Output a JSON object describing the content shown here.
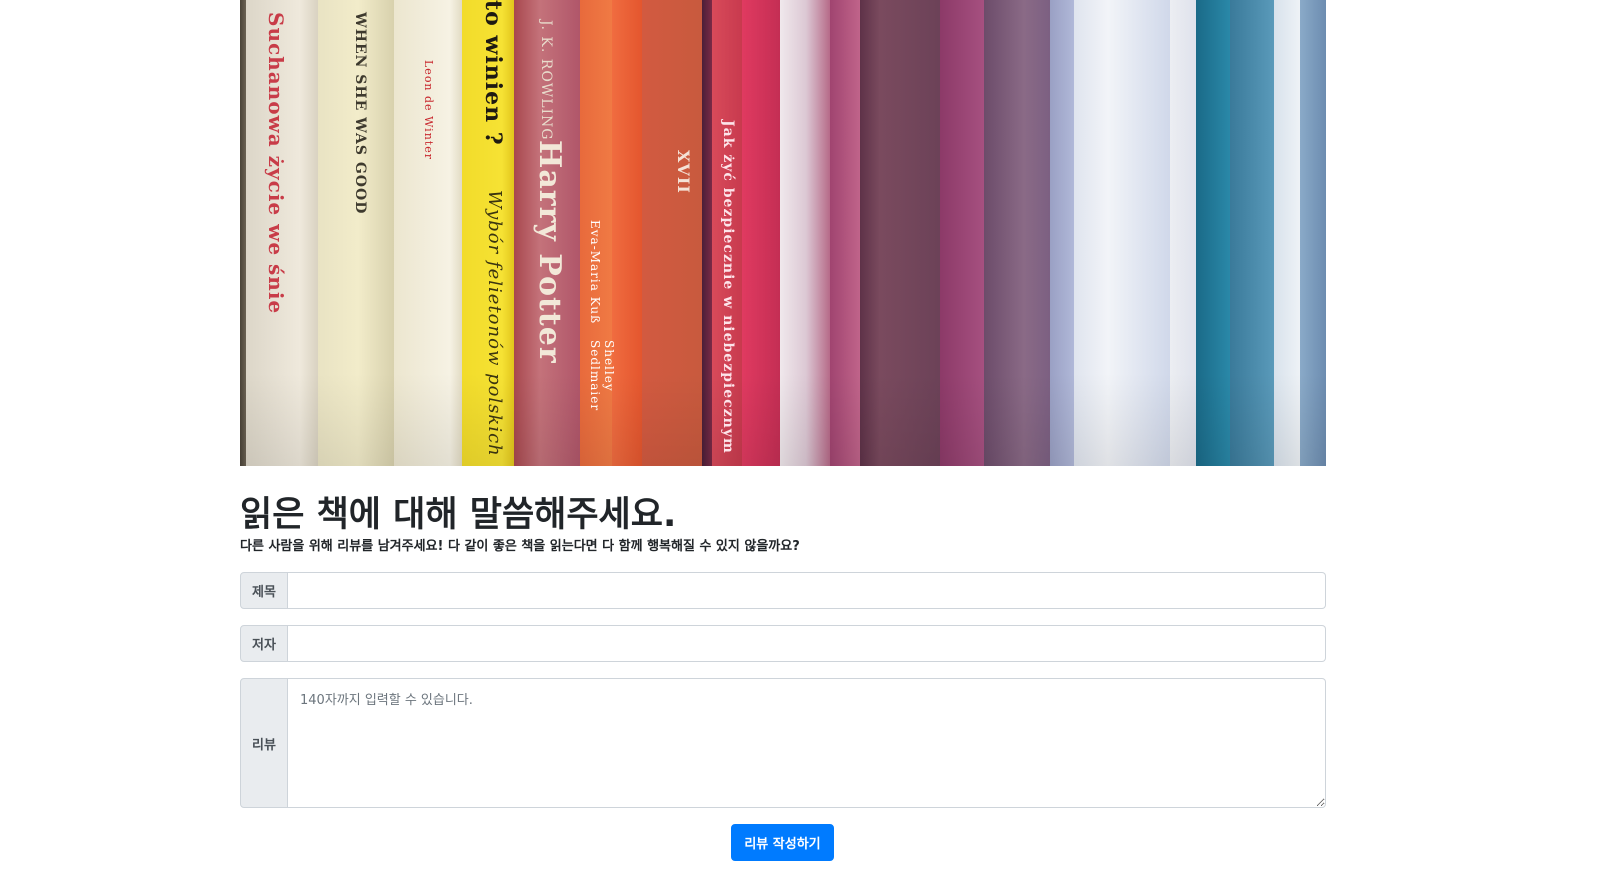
{
  "hero": {
    "image_alt": "bookshelf-image",
    "spines": [
      "Suchanowa życie we śnie",
      "WHEN SHE WAS GOOD",
      "Leon de Winter",
      "to winien ?",
      "Wybór felietonów polskich",
      "Harry Potter",
      "J. K. ROWLING",
      "Eva-Maria Kuß",
      "Shelley Sedlmaier",
      "XVII",
      "Jak żyć bezpiecznie w niebezpiecznym"
    ]
  },
  "page": {
    "title": "읽은 책에 대해 말씀해주세요.",
    "subtitle": "다른 사람을 위해 리뷰를 남겨주세요! 다 같이 좋은 책을 읽는다면 다 함께 행복해질 수 있지 않을까요?"
  },
  "form": {
    "title_label": "제목",
    "title_value": "",
    "author_label": "저자",
    "author_value": "",
    "review_label": "리뷰",
    "review_placeholder": "140자까지 입력할 수 있습니다.",
    "submit_label": "리뷰 작성하기"
  },
  "colors": {
    "primary": "#007bff",
    "addon_bg": "#e9ecef",
    "border": "#ced4da"
  }
}
